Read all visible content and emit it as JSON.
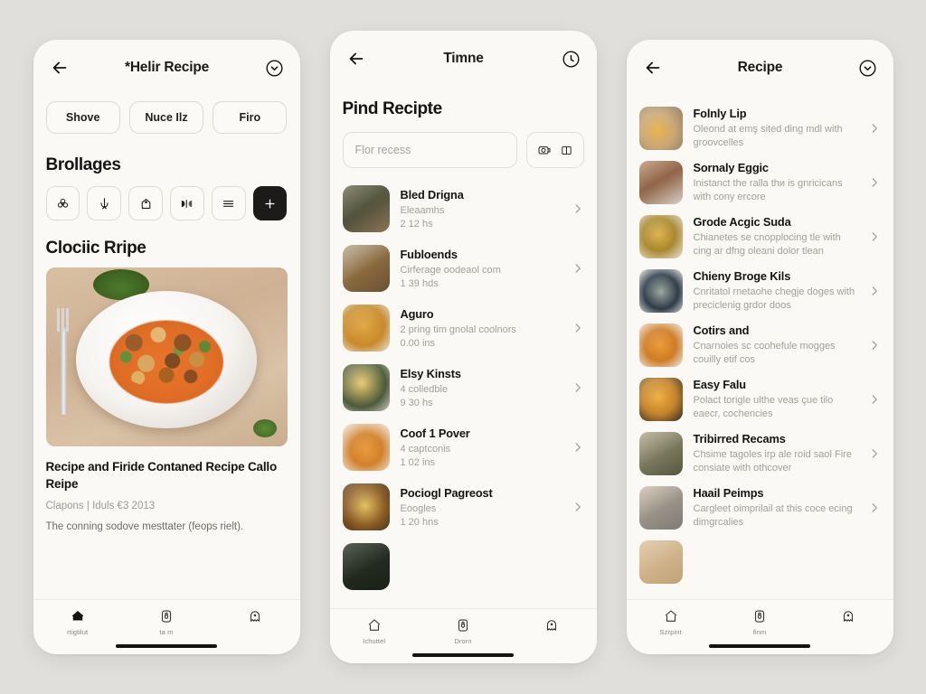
{
  "theme": {
    "background": "#e1dfdc",
    "panel": "#faf9f5",
    "accent": "#1c1b19",
    "text_primary": "#141414",
    "text_muted": "#a3a09a"
  },
  "panel1": {
    "appbar": {
      "title": "*Helir Recipe",
      "back_icon": "back-arrow-icon",
      "action_icon": "chevron-down-circle-icon"
    },
    "pills": [
      {
        "label": "Shove"
      },
      {
        "label": "Nuce Ilz"
      },
      {
        "label": "Firo"
      }
    ],
    "tools_heading": "Brollages",
    "tools": [
      {
        "icon": "flower-icon"
      },
      {
        "icon": "sprout-icon"
      },
      {
        "icon": "tag-icon"
      },
      {
        "icon": "ribbon-icon"
      },
      {
        "icon": "menu-lines-icon"
      },
      {
        "icon": "plus-icon"
      }
    ],
    "hero_heading": "Clociic Rripe",
    "hero_image_alt": "plated-stew-photo",
    "article": {
      "title": "Recipe and Firide Contaned Recipe Callo Reipe",
      "meta": "Clapons | Iduls €3 2013",
      "body": "The conning sodove mesttater (feops rielt)."
    },
    "bottomnav": [
      {
        "icon": "home-icon",
        "label": "rtigtilut",
        "active": true
      },
      {
        "icon": "lock-icon",
        "label": "ta m",
        "active": false
      },
      {
        "icon": "ghost-icon",
        "label": "",
        "active": false
      }
    ]
  },
  "panel2": {
    "appbar": {
      "title": "Timne",
      "back_icon": "back-arrow-icon",
      "action_icon": "clock-circle-icon"
    },
    "heading": "Pind Recipte",
    "search": {
      "placeholder": "Flor recess",
      "value": ""
    },
    "search_actions": [
      {
        "icon": "camera-icon"
      },
      {
        "icon": "columns-icon"
      }
    ],
    "items": [
      {
        "title": "Bled Drigna",
        "sub": "Eleaamhs",
        "sub2": "2 12 hs",
        "thumb": "portrait-person-green"
      },
      {
        "title": "Fubloends",
        "sub": "Cirferage oodeaol com",
        "sub2": "1 39 hds",
        "thumb": "bread-loaf-dish"
      },
      {
        "title": "Aguro",
        "sub": "2 pring tim gnolal coolnors",
        "sub2": "0.00 ins",
        "thumb": "chickpea-bowl"
      },
      {
        "title": "Elsy Kinsts",
        "sub": "4 colledble",
        "sub2": "9 30 hs",
        "thumb": "mixed-rice-plate"
      },
      {
        "title": "Coof 1 Pover",
        "sub": "4 captconis",
        "sub2": "1 02 ins",
        "thumb": "noodle-plate"
      },
      {
        "title": "Pociogl Pagreost",
        "sub": "Eoogles",
        "sub2": "1 20 hns",
        "thumb": "stew-pot"
      },
      {
        "title": "",
        "sub": "",
        "sub2": "",
        "thumb": "dark-greens-bowl"
      }
    ],
    "bottomnav": [
      {
        "icon": "home-icon",
        "label": "Ichuttel",
        "active": false
      },
      {
        "icon": "lock-icon",
        "label": "Drorn",
        "active": false
      },
      {
        "icon": "ghost-icon",
        "label": "",
        "active": false
      }
    ]
  },
  "panel3": {
    "appbar": {
      "title": "Recipe",
      "back_icon": "back-arrow-icon",
      "action_icon": "chevron-down-circle-icon"
    },
    "items": [
      {
        "title": "Folnly Lip",
        "sub": "Oleond at emş sited ding mdl with groovcelles",
        "thumb": "soup-bowl-table"
      },
      {
        "title": "Sornaly Eggic",
        "sub": "Inistanct the ralla thи is gnricicans with cony ercore",
        "thumb": "portrait-woman"
      },
      {
        "title": "Grode Acgic Suda",
        "sub": "Chianetes se cnopplocing tle with cing ar dfng oleani dolor tlean",
        "thumb": "fried-rice-plate"
      },
      {
        "title": "Chieny Broge Kils",
        "sub": "Cnritatol rnetaohe chegje doges with preciclenig grdor doos",
        "thumb": "fish-dark-plate"
      },
      {
        "title": "Cotirs and",
        "sub": "Cnarnoies sc coohefule mogges couilly etif cos",
        "thumb": "orange-noodles"
      },
      {
        "title": "Easy Falu",
        "sub": "Polact torigle ulthe veas çue tilo eaecr, cochencies",
        "thumb": "curry-pan"
      },
      {
        "title": "Tribirred Recams",
        "sub": "Chsime tagoles irp ale roid saol Fire consiate with othcover",
        "thumb": "portrait-man-camo"
      },
      {
        "title": "Haail Peimps",
        "sub": "Cargleet oimprilail at this coce ecing dimgrcalies",
        "thumb": "portrait-man-gray"
      },
      {
        "title": "",
        "sub": "",
        "thumb": "portrait-blond"
      }
    ],
    "bottomnav": [
      {
        "icon": "home-icon",
        "label": "Szrpint",
        "active": false
      },
      {
        "icon": "lock-icon",
        "label": "finm",
        "active": false
      },
      {
        "icon": "ghost-icon",
        "label": "",
        "active": false
      }
    ]
  }
}
